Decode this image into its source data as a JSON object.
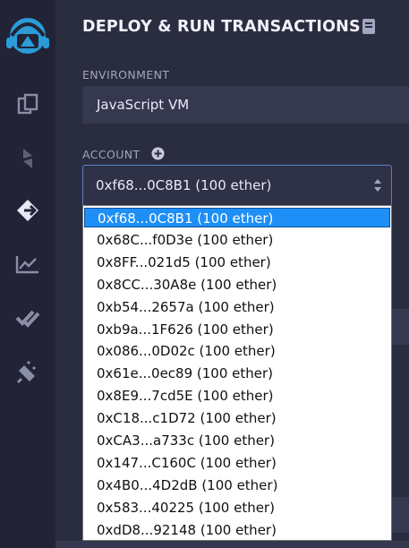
{
  "panel": {
    "title": "DEPLOY & RUN TRANSACTIONS",
    "environment_label": "ENVIRONMENT",
    "environment_value": "JavaScript VM",
    "account_label": "ACCOUNT",
    "account_selected": "0xf68...0C8B1 (100 ether)"
  },
  "rail": {
    "icons": [
      "remix-logo-icon",
      "file-explorer-icon",
      "compiler-icon",
      "deploy-run-icon",
      "analytics-icon",
      "tests-check-icon",
      "plugin-icon"
    ]
  },
  "accounts": [
    "0xf68...0C8B1 (100 ether)",
    "0x68C...f0D3e (100 ether)",
    "0x8FF...021d5 (100 ether)",
    "0x8CC...30A8e (100 ether)",
    "0xb54...2657a (100 ether)",
    "0xb9a...1F626 (100 ether)",
    "0x086...0D02c (100 ether)",
    "0x61e...0ec89 (100 ether)",
    "0x8E9...7cd5E (100 ether)",
    "0xC18...c1D72 (100 ether)",
    "0xCA3...a733c (100 ether)",
    "0x147...C160C (100 ether)",
    "0x4B0...4D2dB (100 ether)",
    "0x583...40225 (100 ether)",
    "0xdD8...92148 (100 ether)"
  ],
  "colors": {
    "background": "#2a2c3f",
    "rail": "#222336",
    "accent": "#1e8ff6",
    "logo": "#2b9cd8"
  }
}
